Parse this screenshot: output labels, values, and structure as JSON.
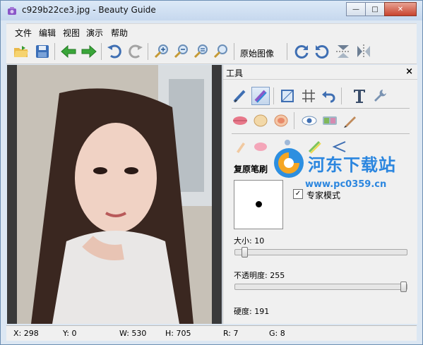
{
  "window": {
    "title": "c929b22ce3.jpg - Beauty Guide",
    "app_icon": "camera-purple-icon",
    "controls": {
      "min": "—",
      "max": "□",
      "close": "✕"
    }
  },
  "menu": [
    "文件",
    "编辑",
    "视图",
    "演示",
    "帮助"
  ],
  "toolbar": {
    "icons": [
      "open-icon",
      "save-icon",
      "back-green-arrow-icon",
      "forward-green-arrow-icon",
      "undo-icon",
      "redo-icon",
      "zoom-in-icon",
      "zoom-out-icon",
      "zoom-fit-icon",
      "zoom-actual-icon"
    ],
    "original_image_label": "原始图像",
    "right_icons": [
      "rotate-cw-icon",
      "rotate-ccw-icon",
      "flip-vertical-icon",
      "flip-horizontal-icon"
    ]
  },
  "panel": {
    "title": "工具",
    "close": "×",
    "row1_icons": [
      "brush-icon",
      "restore-brush-icon",
      "crop-icon",
      "grid-icon",
      "undo-arrow-icon",
      "text-icon",
      "wrench-icon"
    ],
    "row2_icons": [
      "lips-icon",
      "foundation-icon",
      "blush-icon",
      "eye-icon",
      "eyeshadow-icon",
      "pencil-icon"
    ],
    "row3_icons": [
      "concealer-icon",
      "pink-brush-icon",
      "person-icon",
      "highlight-icon",
      "arrow-back-icon"
    ],
    "section_title": "复原笔刷",
    "expert_mode_label": "专家模式",
    "expert_mode_checked": "✓",
    "size_label": "大小: 10",
    "size_value": 10,
    "opacity_label": "不透明度: 255",
    "opacity_value": 255,
    "hardness_label": "硬度: 191"
  },
  "watermark": {
    "text": "河东下载站",
    "url": "www.pc0359.cn"
  },
  "status": {
    "x": "X: 298",
    "y": "Y: 0",
    "w": "W: 530",
    "h": "H: 705",
    "r": "R: 7",
    "g": "G: 8"
  }
}
